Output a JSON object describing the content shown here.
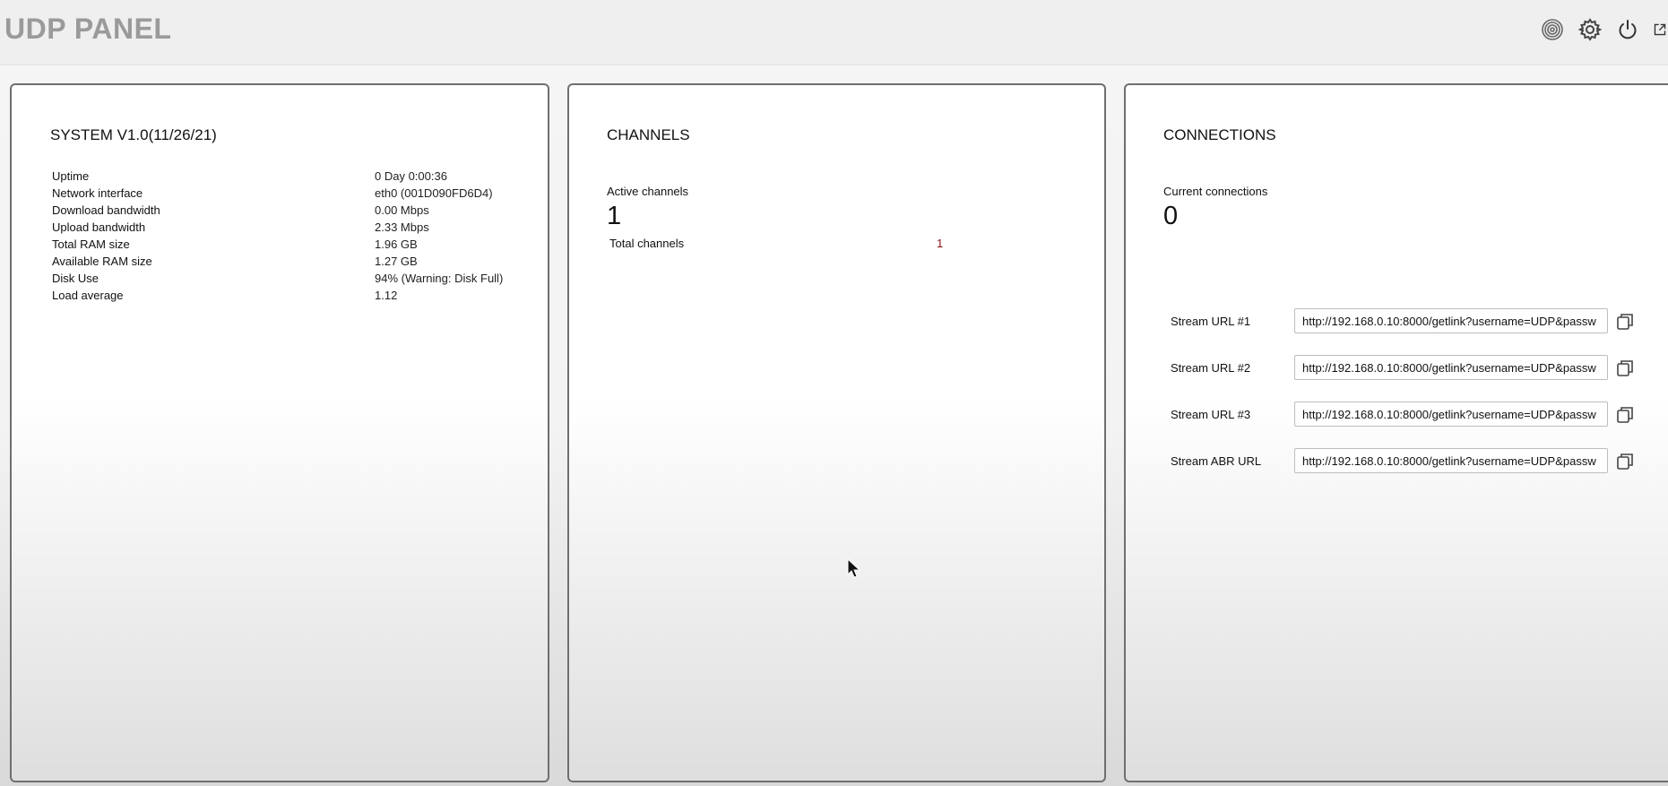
{
  "header": {
    "title": "UDP PANEL",
    "icons": [
      "fingerprint-icon",
      "gear-icon",
      "power-icon",
      "external-link-icon"
    ]
  },
  "system": {
    "title": "SYSTEM V1.0(11/26/21)",
    "rows": [
      {
        "label": "Uptime",
        "value": "0 Day 0:00:36"
      },
      {
        "label": "Network interface",
        "value": "eth0 (001D090FD6D4)"
      },
      {
        "label": "Download bandwidth",
        "value": "0.00 Mbps"
      },
      {
        "label": "Upload bandwidth",
        "value": "2.33 Mbps"
      },
      {
        "label": "Total RAM size",
        "value": "1.96 GB"
      },
      {
        "label": "Available RAM size",
        "value": "1.27 GB"
      },
      {
        "label": "Disk Use",
        "value": "94% (Warning: Disk Full)"
      },
      {
        "label": "Load average",
        "value": "1.12"
      }
    ]
  },
  "channels": {
    "title": "CHANNELS",
    "active_label": "Active channels",
    "active_value": "1",
    "total_label": "Total channels",
    "total_value": "1"
  },
  "connections": {
    "title": "CONNECTIONS",
    "current_label": "Current connections",
    "current_value": "0",
    "streams": [
      {
        "label": "Stream URL #1",
        "url": "http://192.168.0.10:8000/getlink?username=UDP&passw"
      },
      {
        "label": "Stream URL #2",
        "url": "http://192.168.0.10:8000/getlink?username=UDP&passw"
      },
      {
        "label": "Stream URL #3",
        "url": "http://192.168.0.10:8000/getlink?username=UDP&passw"
      },
      {
        "label": "Stream ABR URL",
        "url": "http://192.168.0.10:8000/getlink?username=UDP&passw"
      }
    ]
  },
  "colors": {
    "title_gray": "#9a9a9a",
    "panel_border": "#6f6f6f",
    "total_value_red": "#8a1010"
  }
}
